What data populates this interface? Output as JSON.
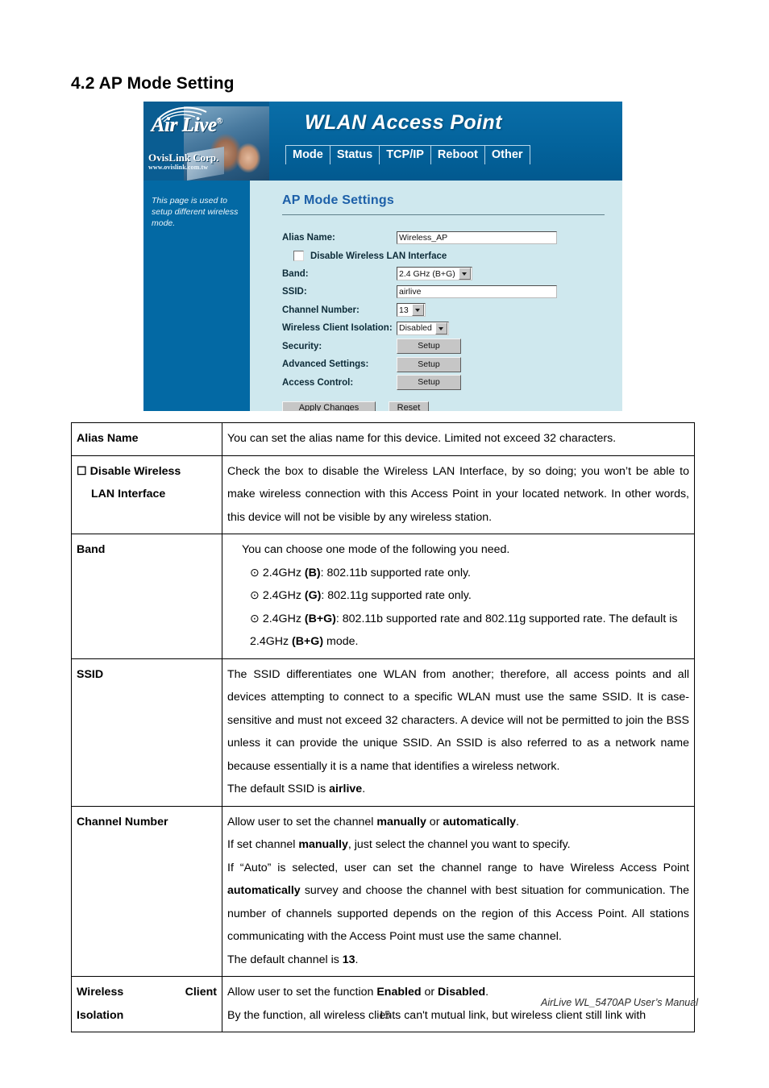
{
  "section": {
    "heading": "4.2 AP Mode Setting"
  },
  "screenshot": {
    "brand": {
      "logo": "Air Live",
      "registered": "®",
      "company": "OvisLink Corp.",
      "url": "www.ovislink.com.tw"
    },
    "title": "WLAN Access Point",
    "nav": [
      {
        "label": "Mode"
      },
      {
        "label": "Status"
      },
      {
        "label": "TCP/IP"
      },
      {
        "label": "Reboot"
      },
      {
        "label": "Other"
      }
    ],
    "side_note": "This page is used to setup different wireless mode.",
    "panel_title": "AP Mode Settings",
    "form": {
      "alias_label": "Alias Name:",
      "alias_value": "Wireless_AP",
      "disable_wlan_label": "Disable Wireless LAN Interface",
      "disable_wlan_checked": false,
      "band_label": "Band:",
      "band_value": "2.4 GHz (B+G)",
      "ssid_label": "SSID:",
      "ssid_value": "airlive",
      "channel_label": "Channel Number:",
      "channel_value": "13",
      "isolation_label": "Wireless Client Isolation:",
      "isolation_value": "Disabled",
      "security_label": "Security:",
      "security_button": "Setup",
      "advanced_label": "Advanced Settings:",
      "advanced_button": "Setup",
      "access_label": "Access Control:",
      "access_button": "Setup",
      "apply_button": "Apply Changes",
      "reset_button": "Reset"
    }
  },
  "table": {
    "rows": [
      {
        "key": "Alias Name",
        "key_justified": false,
        "lines": [
          {
            "text": "You can set the alias name for this device. Limited not exceed 32 characters.",
            "style": "plain"
          }
        ]
      },
      {
        "key": "☐ Disable Wireless",
        "key_second": "LAN Interface",
        "key_justified": false,
        "lines": [
          {
            "text": "Check the box to disable the Wireless LAN Interface, by so doing; you won’t be able to make wireless connection with this Access Point in your located network. In other words, this device will not be visible by any wireless station.",
            "style": "justified"
          }
        ]
      },
      {
        "key": "Band",
        "key_justified": false,
        "lines": [
          {
            "text": "You can choose one mode of the following you need.",
            "style": "plain"
          },
          {
            "text": "⊙ 2.4GHz (B): 802.11b supported rate only.",
            "style": "indent"
          },
          {
            "text": "⊙ 2.4GHz (G): 802.11g supported rate only.",
            "style": "indent"
          },
          {
            "text": "⊙ 2.4GHz (B+G): 802.11b supported rate and 802.11g supported rate. The default is 2.4GHz (B+G) mode.",
            "style": "indent-justified"
          }
        ]
      },
      {
        "key": "SSID",
        "key_justified": false,
        "lines": [
          {
            "text": "The SSID differentiates one WLAN from another; therefore, all access points and all devices attempting to connect to a specific WLAN must use the same SSID. It is case-sensitive and must not exceed 32 characters.   A device will not be permitted to join the BSS unless it can provide the unique SSID. An SSID is also referred to as a network name because essentially it is a name that identifies a wireless network.",
            "style": "justified"
          },
          {
            "text": "The default SSID is airlive.",
            "style": "plain"
          }
        ]
      },
      {
        "key": "Channel Number",
        "key_justified": false,
        "lines": [
          {
            "text": "Allow user to set the channel manually or automatically.",
            "style": "plain"
          },
          {
            "text": "If set channel manually, just select the channel you want to specify.",
            "style": "plain"
          },
          {
            "text": "If “Auto” is selected, user can set the channel range to have Wireless Access Point automatically survey and choose the channel with best situation for communication. The number of channels supported depends on the region of this Access Point. All stations communicating with the Access Point must use the same channel.",
            "style": "justified"
          },
          {
            "text": "The default channel is 13.",
            "style": "plain"
          }
        ]
      },
      {
        "key": "Wireless",
        "key_tail": "Client",
        "key_second": "Isolation",
        "key_justified": true,
        "lines": [
          {
            "text": "Allow user to set the function Enabled or Disabled.",
            "style": "plain"
          },
          {
            "text": "By the function, all wireless clients can't mutual link, but wireless client still link with",
            "style": "plain"
          }
        ]
      }
    ]
  },
  "footer": {
    "page_number": "15",
    "manual": "AirLive WL_5470AP User’s Manual"
  }
}
